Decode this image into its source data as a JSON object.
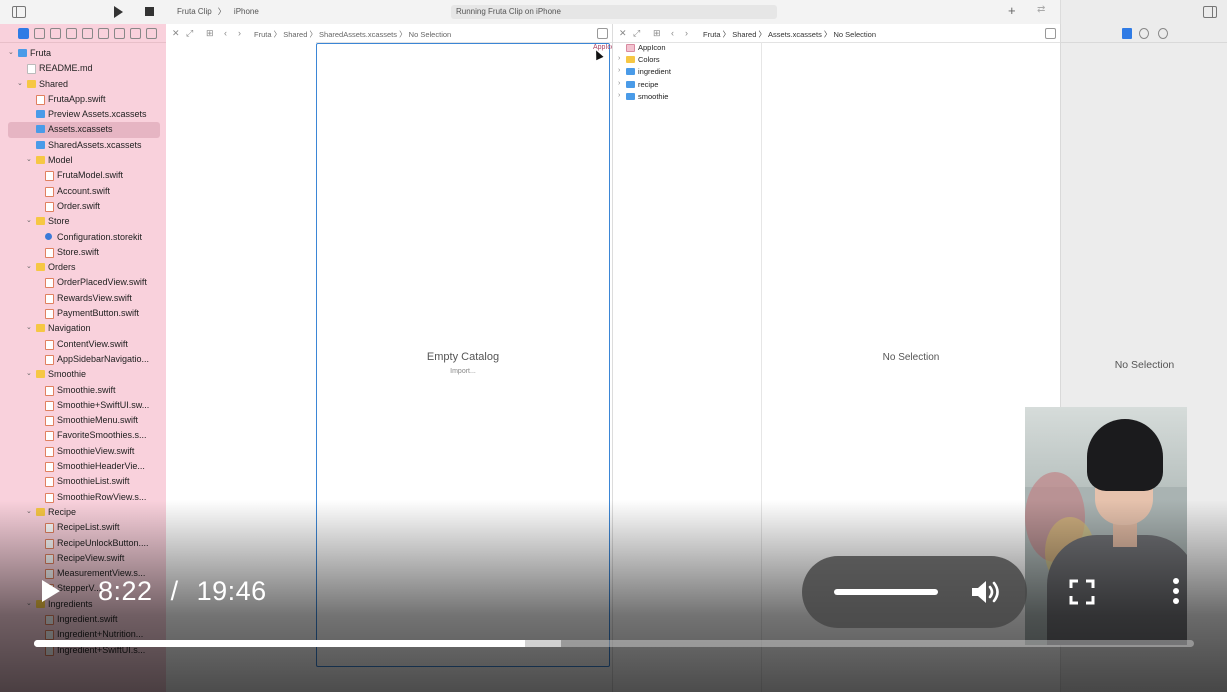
{
  "toolbar": {
    "scheme_target": "Fruta Clip",
    "scheme_device": "iPhone",
    "status": "Running Fruta Clip on iPhone"
  },
  "navigator": {
    "items": [
      {
        "label": "Fruta",
        "depth": 0,
        "kind": "blue",
        "disclosure": "v"
      },
      {
        "label": "README.md",
        "depth": 1,
        "kind": "doc"
      },
      {
        "label": "Shared",
        "depth": 1,
        "kind": "folder",
        "disclosure": "v"
      },
      {
        "label": "FrutaApp.swift",
        "depth": 2,
        "kind": "swift"
      },
      {
        "label": "Preview Assets.xcassets",
        "depth": 2,
        "kind": "blue"
      },
      {
        "label": "Assets.xcassets",
        "depth": 2,
        "kind": "blue",
        "selected": true
      },
      {
        "label": "SharedAssets.xcassets",
        "depth": 2,
        "kind": "blue"
      },
      {
        "label": "Model",
        "depth": 2,
        "kind": "folder",
        "disclosure": "v"
      },
      {
        "label": "FrutaModel.swift",
        "depth": 3,
        "kind": "swift"
      },
      {
        "label": "Account.swift",
        "depth": 3,
        "kind": "swift"
      },
      {
        "label": "Order.swift",
        "depth": 3,
        "kind": "swift"
      },
      {
        "label": "Store",
        "depth": 2,
        "kind": "folder",
        "disclosure": "v"
      },
      {
        "label": "Configuration.storekit",
        "depth": 3,
        "kind": "store"
      },
      {
        "label": "Store.swift",
        "depth": 3,
        "kind": "swift"
      },
      {
        "label": "Orders",
        "depth": 2,
        "kind": "folder",
        "disclosure": "v"
      },
      {
        "label": "OrderPlacedView.swift",
        "depth": 3,
        "kind": "swift"
      },
      {
        "label": "RewardsView.swift",
        "depth": 3,
        "kind": "swift"
      },
      {
        "label": "PaymentButton.swift",
        "depth": 3,
        "kind": "swift"
      },
      {
        "label": "Navigation",
        "depth": 2,
        "kind": "folder",
        "disclosure": "v"
      },
      {
        "label": "ContentView.swift",
        "depth": 3,
        "kind": "swift"
      },
      {
        "label": "AppSidebarNavigatio...",
        "depth": 3,
        "kind": "swift"
      },
      {
        "label": "Smoothie",
        "depth": 2,
        "kind": "folder",
        "disclosure": "v"
      },
      {
        "label": "Smoothie.swift",
        "depth": 3,
        "kind": "swift"
      },
      {
        "label": "Smoothie+SwiftUI.sw...",
        "depth": 3,
        "kind": "swift"
      },
      {
        "label": "SmoothieMenu.swift",
        "depth": 3,
        "kind": "swift"
      },
      {
        "label": "FavoriteSmoothies.s...",
        "depth": 3,
        "kind": "swift"
      },
      {
        "label": "SmoothieView.swift",
        "depth": 3,
        "kind": "swift"
      },
      {
        "label": "SmoothieHeaderVie...",
        "depth": 3,
        "kind": "swift"
      },
      {
        "label": "SmoothieList.swift",
        "depth": 3,
        "kind": "swift"
      },
      {
        "label": "SmoothieRowView.s...",
        "depth": 3,
        "kind": "swift"
      },
      {
        "label": "Recipe",
        "depth": 2,
        "kind": "folder",
        "disclosure": "v"
      },
      {
        "label": "RecipeList.swift",
        "depth": 3,
        "kind": "swift"
      },
      {
        "label": "RecipeUnlockButton....",
        "depth": 3,
        "kind": "swift"
      },
      {
        "label": "RecipeView.swift",
        "depth": 3,
        "kind": "swift"
      },
      {
        "label": "MeasurementView.s...",
        "depth": 3,
        "kind": "swift"
      },
      {
        "label": "StepperV...",
        "depth": 3,
        "kind": "swift"
      },
      {
        "label": "Ingredients",
        "depth": 2,
        "kind": "folder",
        "disclosure": "v"
      },
      {
        "label": "Ingredient.swift",
        "depth": 3,
        "kind": "swift"
      },
      {
        "label": "Ingredient+Nutrition...",
        "depth": 3,
        "kind": "swift"
      },
      {
        "label": "Ingredient+SwiftUI.s...",
        "depth": 3,
        "kind": "swift"
      }
    ]
  },
  "editor_left": {
    "breadcrumb": [
      "Fruta",
      "Shared",
      "SharedAssets.xcassets",
      "No Selection"
    ],
    "empty_title": "Empty Catalog",
    "empty_action": "Import...",
    "peek_label": "AppIco..."
  },
  "editor_right": {
    "breadcrumb": [
      "Fruta",
      "Shared",
      "Assets.xcassets",
      "No Selection"
    ],
    "assets": [
      {
        "label": "AppIcon",
        "kind": "app",
        "disclosure": ""
      },
      {
        "label": "Colors",
        "kind": "folder",
        "disclosure": ">"
      },
      {
        "label": "ingredient",
        "kind": "blue",
        "disclosure": ">"
      },
      {
        "label": "recipe",
        "kind": "blue",
        "disclosure": ">"
      },
      {
        "label": "smoothie",
        "kind": "blue",
        "disclosure": ">"
      }
    ],
    "detail_empty": "No Selection"
  },
  "inspector": {
    "empty": "No Selection"
  },
  "video": {
    "current_time": "8:22",
    "separator": "/",
    "duration": "19:46",
    "played_fraction": 0.423,
    "buffered_fraction": 0.454,
    "volume_fraction": 1.0
  }
}
